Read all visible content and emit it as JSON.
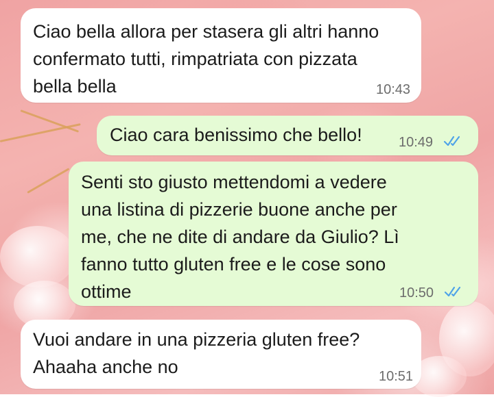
{
  "chat": {
    "messages": [
      {
        "direction": "incoming",
        "text": "Ciao bella allora per stasera gli altri hanno\nconfermato tutti, rimpatriata con pizzata\nbella bella",
        "time": "10:43"
      },
      {
        "direction": "outgoing",
        "text": "Ciao cara benissimo che bello!",
        "time": "10:49",
        "status_icon": "double-check-read-icon"
      },
      {
        "direction": "outgoing",
        "text": "Senti sto giusto mettendomi a vedere\nuna listina di pizzerie buone anche per\nme, che ne dite di andare da Giulio? Lì\nfanno tutto gluten free e le cose sono\nottime",
        "time": "10:50",
        "status_icon": "double-check-read-icon"
      },
      {
        "direction": "incoming",
        "text": "Vuoi andare in una pizzeria gluten free?\nAhaaha anche no",
        "time": "10:51"
      }
    ]
  },
  "colors": {
    "incoming_bubble": "#ffffff",
    "outgoing_bubble": "#e5fbd5",
    "read_ticks": "#4fa3e8",
    "wallpaper_base": "#f0a3a3"
  }
}
